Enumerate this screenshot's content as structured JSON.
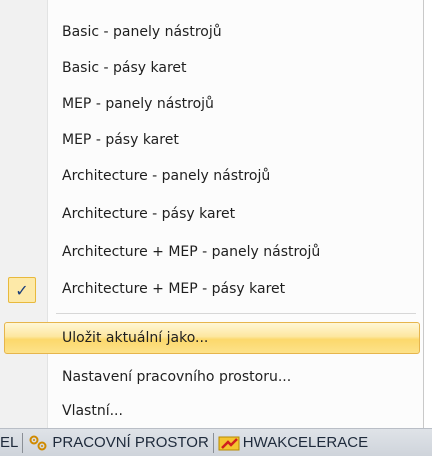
{
  "menu": {
    "items": [
      {
        "label": "Basic - panely nástrojů",
        "checked": false
      },
      {
        "label": "Basic - pásy karet",
        "checked": false
      },
      {
        "label": "MEP - panely nástrojů",
        "checked": false
      },
      {
        "label": "MEP - pásy karet",
        "checked": false
      },
      {
        "label": "Architecture - panely nástrojů",
        "checked": false
      },
      {
        "label": "Architecture - pásy karet",
        "checked": false
      },
      {
        "label": "Architecture + MEP - panely nástrojů",
        "checked": false
      },
      {
        "label": "Architecture + MEP - pásy karet",
        "checked": true
      }
    ],
    "check_glyph": "✓",
    "save_as": "Uložit aktuální jako...",
    "workspace_settings": "Nastavení pracovního prostoru...",
    "custom": "Vlastní..."
  },
  "statusbar": {
    "left_fragment": "EL",
    "workspace_label": "PRACOVNÍ PROSTOR",
    "hw_label": "HWAKCELERACE",
    "workspace_icon": "gear-icon",
    "hw_icon": "hardware-acceleration-icon"
  },
  "colors": {
    "highlight": "#fcd86c",
    "check_background": "#fde9a8",
    "check_color": "#1a3d7a"
  }
}
